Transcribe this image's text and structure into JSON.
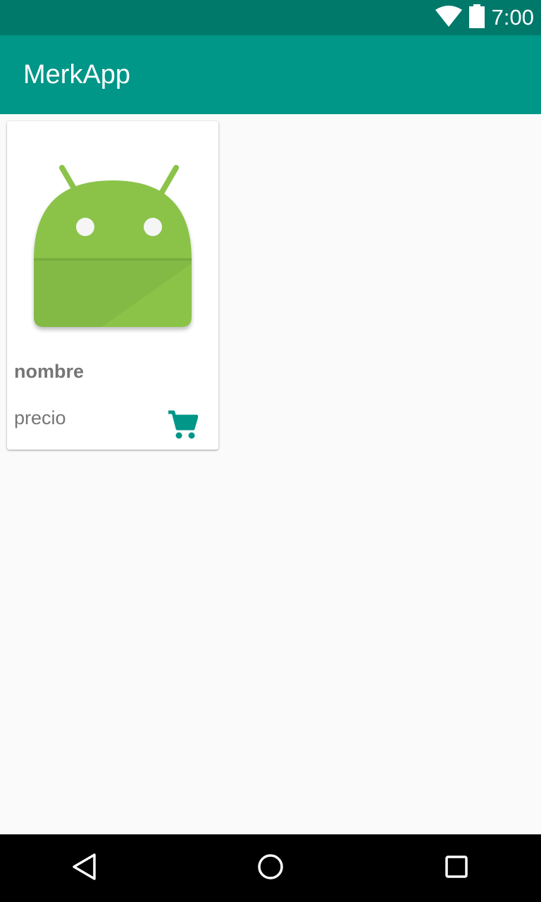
{
  "status_bar": {
    "time": "7:00",
    "icons": [
      "wifi-icon",
      "battery-icon"
    ]
  },
  "app_bar": {
    "title": "MerkApp"
  },
  "products": [
    {
      "image": "android-robot-placeholder",
      "name": "nombre",
      "price": "precio",
      "action_icon": "shopping-cart-icon"
    }
  ],
  "navigation_bar": {
    "buttons": [
      "back-icon",
      "home-icon",
      "recents-icon"
    ]
  },
  "colors": {
    "status_bar": "#00796b",
    "app_bar": "#009688",
    "accent": "#009688",
    "background": "#fafafa",
    "secondary_text": "#757575",
    "android_green": "#8bc34a"
  }
}
